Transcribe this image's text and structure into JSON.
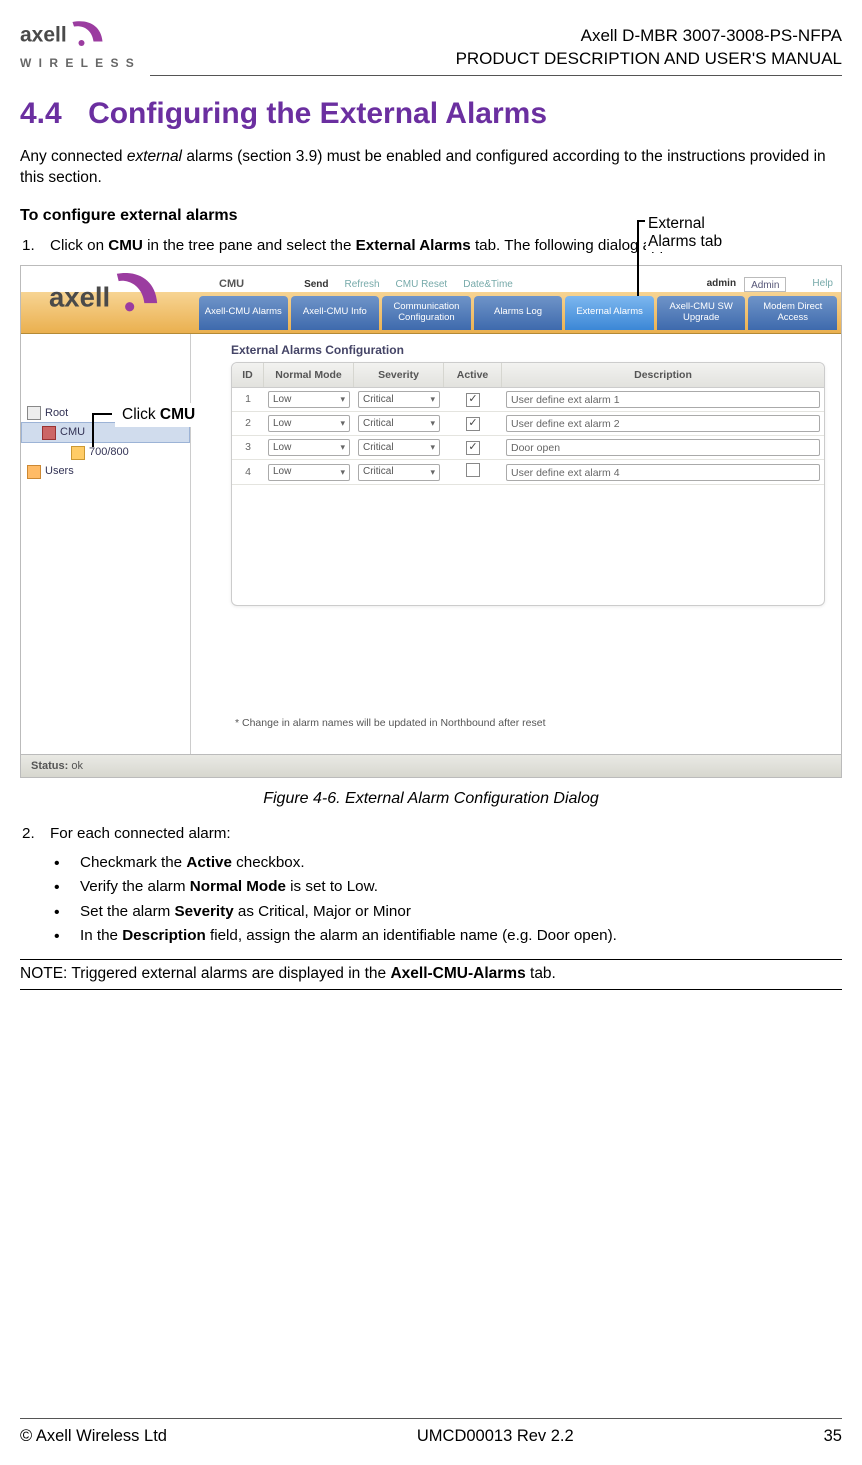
{
  "header": {
    "brand_wordmark": "axell",
    "brand_sub": "W I R E L E S S",
    "doc_line1": "Axell D-MBR 3007-3008-PS-NFPA",
    "doc_line2": "PRODUCT DESCRIPTION AND USER'S MANUAL"
  },
  "section": {
    "number": "4.4",
    "title": "Configuring the External Alarms"
  },
  "intro_prefix": "Any connected ",
  "intro_italic": "external",
  "intro_suffix": " alarms (section 3.9) must be enabled and configured according to the instructions provided in this section.",
  "subhead": "To configure external alarms",
  "step1": {
    "num": "1.",
    "pre": "Click on ",
    "b1": "CMU",
    "mid": " in the tree pane and select the ",
    "b2": "External Alarms",
    "post": " tab. The following dialog appears."
  },
  "callouts": {
    "external_alarms_tab_l1": "External",
    "external_alarms_tab_l2": "Alarms tab",
    "click_cmu_pre": "Click ",
    "click_cmu_b": "CMU"
  },
  "screenshot": {
    "crumb": "CMU",
    "topbtns": [
      "Send",
      "Refresh",
      "CMU Reset",
      "Date&Time"
    ],
    "admin_label": "admin",
    "admin_value": "Admin",
    "help": "Help",
    "tabs": [
      "Axell-CMU Alarms",
      "Axell-CMU Info",
      "Communication Configuration",
      "Alarms Log",
      "External Alarms",
      "Axell-CMU SW Upgrade",
      "Modem Direct Access"
    ],
    "active_tab_index": 4,
    "panel_title": "External Alarms Configuration",
    "columns": {
      "id": "ID",
      "nm": "Normal Mode",
      "sv": "Severity",
      "ac": "Active",
      "de": "Description"
    },
    "rows": [
      {
        "id": "1",
        "normal": "Low",
        "severity": "Critical",
        "active": true,
        "desc": "User define ext alarm 1"
      },
      {
        "id": "2",
        "normal": "Low",
        "severity": "Critical",
        "active": true,
        "desc": "User define ext alarm 2"
      },
      {
        "id": "3",
        "normal": "Low",
        "severity": "Critical",
        "active": true,
        "desc": "Door open"
      },
      {
        "id": "4",
        "normal": "Low",
        "severity": "Critical",
        "active": false,
        "desc": "User define ext alarm 4"
      }
    ],
    "tree": {
      "root": "Root",
      "cmu": "CMU",
      "child": "700/800",
      "users": "Users"
    },
    "panel_note": "* Change in alarm names will be updated in Northbound after reset",
    "status_label": "Status:",
    "status_value": "ok"
  },
  "fig_caption": "Figure 4-6. External Alarm Configuration Dialog",
  "step2": {
    "num": "2.",
    "text": "For each connected alarm:"
  },
  "bullets": {
    "b1_pre": "Checkmark the ",
    "b1_b": "Active",
    "b1_post": " checkbox.",
    "b2_pre": "Verify the alarm ",
    "b2_b": "Normal Mode",
    "b2_post": " is set to Low.",
    "b3_pre": "Set the alarm ",
    "b3_b": "Severity",
    "b3_post": " as Critical, Major or Minor",
    "b4_pre": "In the ",
    "b4_b": "Description",
    "b4_post": " field, assign the alarm an identifiable name (e.g. Door open)."
  },
  "note": {
    "label": "NOTE:",
    "pre": "  Triggered external alarms are displayed in the ",
    "b": "Axell-CMU-Alarms",
    "post": " tab."
  },
  "footer": {
    "left": "© Axell Wireless Ltd",
    "center": "UMCD00013 Rev 2.2",
    "right": "35"
  }
}
